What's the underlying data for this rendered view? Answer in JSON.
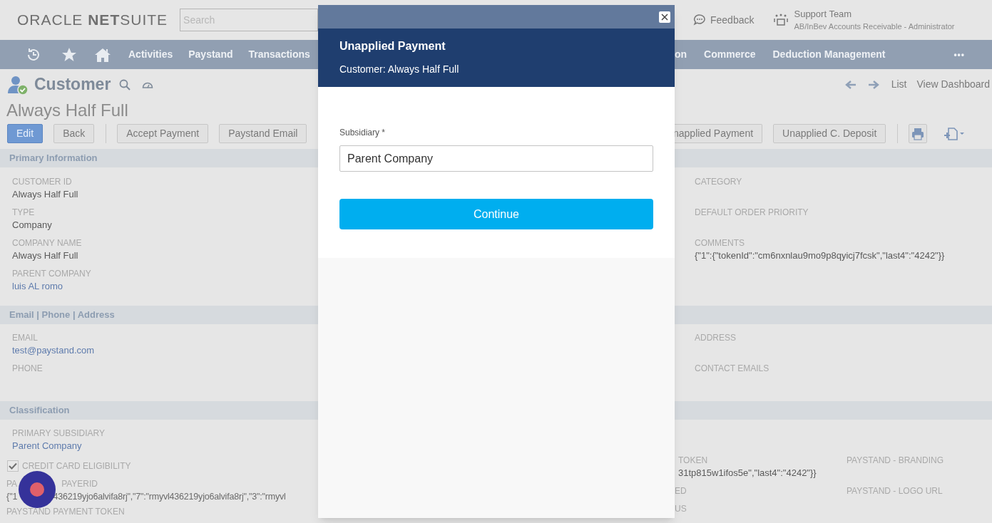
{
  "header": {
    "logo": "ORACLE **NET**SUITE",
    "search": {
      "placeholder": "Search"
    },
    "feedback": "Feedback",
    "user": {
      "name": "Support Team",
      "role": "AB/InBev Accounts Receivable - Administrator"
    }
  },
  "nav": {
    "left": [
      "Activities",
      "Paystand",
      "Transactions"
    ],
    "right": [
      "on",
      "Commerce",
      "Deduction Management"
    ],
    "more": "•••"
  },
  "record": {
    "type": "Customer",
    "name": "Always Half Full",
    "links": [
      "List",
      "View Dashboard"
    ]
  },
  "buttons_left": [
    {
      "label": "Edit",
      "primary": true
    },
    {
      "label": "Back",
      "primary": false
    },
    {
      "label": "Accept Payment",
      "primary": false
    },
    {
      "label": "Paystand Email",
      "primary": false
    }
  ],
  "buttons_right": [
    "napplied Payment",
    "Unapplied C. Deposit"
  ],
  "primary_information": {
    "title": "Primary Information",
    "left": [
      {
        "label": "CUSTOMER ID",
        "value": "Always Half Full",
        "link": false
      },
      {
        "label": "TYPE",
        "value": "Company",
        "link": false
      },
      {
        "label": "COMPANY NAME",
        "value": "Always Half Full",
        "link": false
      },
      {
        "label": "PARENT COMPANY",
        "value": "luis AL romo",
        "link": true
      }
    ],
    "right": [
      {
        "label": "CATEGORY"
      },
      {
        "label": "DEFAULT ORDER PRIORITY"
      },
      {
        "label": "COMMENTS",
        "value": "{\"1\":{\"tokenId\":\"cm6nxnlau9mo9p8qyicj7fcsk\",\"last4\":\"4242\"}}",
        "link": false
      }
    ]
  },
  "email_phone_address": {
    "title": "Email | Phone | Address",
    "left": [
      {
        "label": "EMAIL",
        "value": "test@paystand.com",
        "link": true
      },
      {
        "label": "PHONE"
      }
    ],
    "right": [
      {
        "label": "ADDRESS"
      },
      {
        "label": "CONTACT EMAILS"
      }
    ]
  },
  "classification": {
    "title": "Classification",
    "left": [
      {
        "kind": "field",
        "label": "PRIMARY SUBSIDIARY",
        "value": "Parent Company",
        "link": true
      },
      {
        "kind": "checkbox",
        "label": "CREDIT CARD ELIGIBILITY",
        "checked": true
      },
      {
        "kind": "split",
        "label_parts": [
          "PA",
          "PAYERID"
        ],
        "value_parts": [
          "{\"1",
          "436219yjo6alvifa8rj\",\"7\":\"rmyvl436219yjo6alvifa8rj\",\"3\":\"rmyvl"
        ]
      },
      {
        "kind": "field",
        "label": "PAYSTAND PAYMENT TOKEN"
      }
    ],
    "right_a": [
      {
        "label": "TOKEN",
        "value": "31tp815w1ifos5e\",\"last4\":\"4242\"}}",
        "link": false
      },
      {
        "label": "ED"
      },
      {
        "label": "US"
      }
    ],
    "right_b": [
      {
        "label": "PAYSTAND - BRANDING"
      },
      {
        "label": "PAYSTAND - LOGO URL"
      }
    ]
  },
  "modal": {
    "title": "Unapplied Payment",
    "subtitle": "Customer: Always Half Full",
    "field": {
      "label": "Subsidiary *",
      "value": "Parent Company"
    },
    "button": "Continue"
  }
}
